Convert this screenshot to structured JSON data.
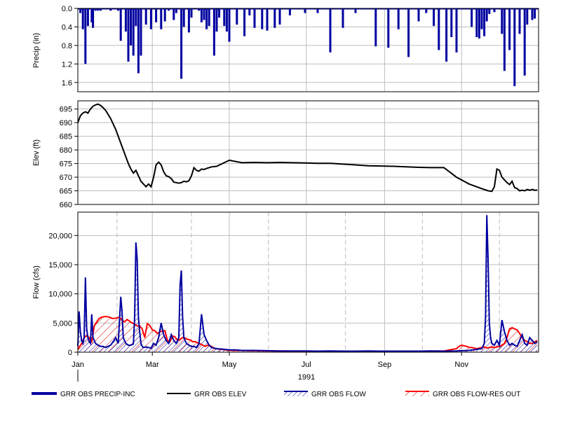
{
  "chart_data": [
    {
      "type": "bar",
      "panel": "precip",
      "ylabel": "Precip (in)",
      "ylim": [
        0,
        1.8
      ],
      "y_inverted": true,
      "yticks": [
        "0.0",
        "0.4",
        "0.8",
        "1.2",
        "1.6"
      ],
      "yticks_values": [
        0,
        0.4,
        0.8,
        1.2,
        1.6
      ],
      "grid": true,
      "color": "#0000a0",
      "x_domain": "day of year 1991",
      "series": [
        {
          "name": "GRR OBS PRECIP-INC",
          "x": [
            2,
            4,
            6,
            8,
            11,
            12,
            14,
            16,
            18,
            22,
            26,
            28,
            32,
            34,
            38,
            40,
            42,
            44,
            46,
            48,
            50,
            54,
            58,
            62,
            66,
            69,
            72,
            76,
            78,
            82,
            84,
            88,
            90,
            96,
            98,
            100,
            102,
            104,
            108,
            110,
            112,
            116,
            118,
            120,
            126,
            132,
            136,
            140,
            146,
            150,
            156,
            160,
            168,
            180,
            190,
            200,
            210,
            220,
            236,
            246,
            254,
            262,
            270,
            276,
            282,
            286,
            292,
            296,
            300,
            312,
            316,
            318,
            320,
            322,
            324,
            326,
            330,
            336,
            338,
            342,
            346,
            350,
            354,
            356,
            360,
            362
          ],
          "y": [
            0.1,
            0.45,
            1.2,
            0.38,
            0.3,
            0.42,
            0.05,
            0.05,
            0.05,
            0.02,
            0.05,
            0.02,
            0.05,
            0.7,
            0.5,
            1.15,
            0.8,
            1.02,
            0.38,
            1.4,
            1.02,
            0.35,
            0.45,
            0.3,
            0.45,
            0.28,
            0.05,
            0.25,
            0.1,
            1.52,
            0.4,
            0.52,
            0.2,
            0.05,
            0.3,
            0.25,
            0.45,
            0.38,
            1.02,
            0.5,
            0.2,
            0.38,
            0.5,
            0.72,
            0.35,
            0.6,
            0.15,
            0.42,
            0.45,
            0.48,
            0.42,
            0.35,
            0.15,
            0.1,
            0.1,
            0.95,
            0.42,
            0.1,
            0.82,
            0.85,
            0.45,
            1.05,
            0.28,
            0.1,
            0.38,
            0.9,
            1.15,
            0.62,
            0.95,
            0.4,
            0.62,
            0.65,
            0.45,
            0.6,
            0.28,
            0.12,
            0.08,
            0.55,
            1.35,
            0.9,
            1.68,
            0.55,
            1.45,
            0.35,
            0.25,
            0.22
          ]
        }
      ]
    },
    {
      "type": "line",
      "panel": "elev",
      "ylabel": "Elev (ft)",
      "ylim": [
        660,
        698
      ],
      "yticks": [
        "660",
        "665",
        "670",
        "675",
        "680",
        "685",
        "690",
        "695"
      ],
      "yticks_values": [
        660,
        665,
        670,
        675,
        680,
        685,
        690,
        695
      ],
      "grid": true,
      "series": [
        {
          "name": "GRR OBS ELEV",
          "color": "#000000",
          "x": [
            0,
            2,
            4,
            6,
            8,
            10,
            12,
            14,
            16,
            18,
            20,
            22,
            24,
            26,
            28,
            30,
            32,
            34,
            36,
            38,
            40,
            42,
            44,
            46,
            48,
            50,
            52,
            54,
            56,
            58,
            60,
            62,
            64,
            66,
            68,
            70,
            72,
            74,
            76,
            78,
            80,
            82,
            84,
            86,
            88,
            90,
            92,
            94,
            96,
            98,
            100,
            102,
            104,
            106,
            110,
            120,
            130,
            140,
            150,
            160,
            170,
            180,
            190,
            200,
            210,
            220,
            230,
            240,
            250,
            260,
            270,
            280,
            290,
            300,
            310,
            320,
            325,
            328,
            330,
            332,
            334,
            336,
            338,
            340,
            342,
            344,
            346,
            348,
            350,
            352,
            354,
            356,
            358,
            360,
            362,
            364
          ],
          "y": [
            690,
            692.5,
            693.5,
            694,
            693.5,
            695,
            696,
            696.5,
            696.8,
            696.3,
            695.5,
            694.5,
            693,
            691.5,
            689.5,
            687.5,
            685,
            682.5,
            680,
            677.5,
            675,
            673,
            671.5,
            672.5,
            670.5,
            668.5,
            667.5,
            666.5,
            667.5,
            666.5,
            670,
            674.5,
            675.5,
            674.5,
            672,
            670.5,
            670.2,
            669.5,
            668.2,
            668,
            667.8,
            668,
            668.5,
            668.3,
            668.7,
            670.5,
            673.5,
            672.5,
            672.2,
            673,
            672.8,
            673.2,
            673.5,
            673.8,
            674,
            676.2,
            675.3,
            675.4,
            675.3,
            675.4,
            675.3,
            675.2,
            675.1,
            675.1,
            674.8,
            674.5,
            674.2,
            674.1,
            674,
            673.8,
            673.6,
            673.5,
            673.5,
            670,
            667.5,
            665.8,
            665,
            664.8,
            666.5,
            673,
            672.5,
            670,
            669,
            668,
            667.3,
            668.5,
            666.2,
            665.8,
            665,
            665.2,
            665,
            665.5,
            665.2,
            665.5,
            665.2,
            665.3
          ]
        }
      ]
    },
    {
      "type": "area",
      "panel": "flow",
      "ylabel": "Flow (cfs)",
      "ylim": [
        0,
        24000
      ],
      "yticks": [
        "0",
        "5,000",
        "10,000",
        "15,000",
        "20,000"
      ],
      "yticks_values": [
        0,
        5000,
        10000,
        15000,
        20000
      ],
      "xtick_labels": [
        "Jan",
        "Mar",
        "May",
        "Jul",
        "Sep",
        "Nov"
      ],
      "xtick_days": [
        0,
        59,
        120,
        181,
        243,
        304
      ],
      "year_label": "1991",
      "grid": true,
      "series": [
        {
          "name": "GRR OBS FLOW",
          "color": "#0000a0",
          "x": [
            0,
            1,
            2,
            3,
            4,
            5,
            6,
            7,
            8,
            9,
            10,
            11,
            12,
            14,
            16,
            18,
            20,
            22,
            24,
            26,
            28,
            30,
            32,
            34,
            35,
            36,
            37,
            38,
            40,
            42,
            44,
            45,
            46,
            47,
            48,
            49,
            50,
            51,
            52,
            54,
            56,
            58,
            60,
            62,
            64,
            66,
            68,
            70,
            72,
            74,
            76,
            78,
            80,
            81,
            82,
            83,
            84,
            86,
            88,
            90,
            92,
            94,
            96,
            98,
            100,
            102,
            104,
            106,
            108,
            110,
            115,
            120,
            125,
            130,
            140,
            150,
            160,
            170,
            180,
            190,
            200,
            210,
            220,
            230,
            240,
            250,
            260,
            270,
            280,
            290,
            300,
            310,
            320,
            322,
            323,
            324,
            325,
            326,
            327,
            328,
            330,
            332,
            334,
            336,
            338,
            340,
            342,
            344,
            346,
            348,
            350,
            352,
            354,
            356,
            358,
            360,
            362,
            364
          ],
          "y": [
            1000,
            7000,
            3500,
            2000,
            1500,
            2500,
            12800,
            4000,
            2500,
            1800,
            1500,
            6500,
            2500,
            1500,
            1200,
            1000,
            1000,
            800,
            1000,
            1200,
            1800,
            2500,
            1500,
            9500,
            7000,
            2500,
            2000,
            1500,
            1200,
            1200,
            1400,
            6000,
            18800,
            16000,
            6000,
            3500,
            1500,
            1000,
            800,
            900,
            800,
            700,
            1500,
            1200,
            2500,
            5000,
            3000,
            2000,
            1500,
            3000,
            2000,
            1500,
            2500,
            11500,
            14000,
            6000,
            2500,
            1500,
            1200,
            1000,
            1000,
            800,
            1500,
            6500,
            3000,
            2000,
            1200,
            800,
            700,
            600,
            500,
            400,
            400,
            300,
            300,
            250,
            200,
            200,
            200,
            180,
            200,
            180,
            180,
            200,
            180,
            180,
            180,
            180,
            200,
            180,
            200,
            300,
            600,
            1500,
            6000,
            23500,
            16000,
            5000,
            2500,
            1500,
            1200,
            2000,
            1200,
            5500,
            3500,
            2000,
            1200,
            1500,
            1200,
            1000,
            2000,
            3000,
            1500,
            1200,
            2500,
            2000,
            1500,
            1800
          ]
        },
        {
          "name": "GRR OBS FLOW-RES OUT",
          "color": "#ff0000",
          "x": [
            0,
            3,
            5,
            7,
            9,
            11,
            13,
            15,
            17,
            19,
            21,
            23,
            25,
            27,
            29,
            31,
            33,
            35,
            37,
            39,
            41,
            43,
            45,
            47,
            49,
            51,
            53,
            55,
            57,
            59,
            61,
            63,
            65,
            67,
            69,
            71,
            73,
            75,
            77,
            79,
            81,
            83,
            85,
            87,
            89,
            91,
            93,
            95,
            97,
            99,
            101,
            103,
            105,
            107,
            109,
            113,
            117,
            121,
            125,
            135,
            150,
            170,
            200,
            230,
            260,
            290,
            300,
            302,
            304,
            306,
            308,
            310,
            312,
            314,
            316,
            318,
            320,
            322,
            324,
            326,
            328,
            330,
            332,
            334,
            336,
            338,
            340,
            342,
            344,
            346,
            348,
            350,
            352,
            354,
            356,
            358,
            360,
            362,
            364
          ],
          "y": [
            500,
            1500,
            2500,
            2800,
            2500,
            1800,
            4500,
            5200,
            5800,
            6000,
            6100,
            6100,
            6000,
            5800,
            5800,
            5900,
            6000,
            5500,
            5200,
            5600,
            5300,
            5000,
            4800,
            4500,
            4500,
            4000,
            2500,
            4900,
            4600,
            3800,
            3700,
            3200,
            3500,
            3600,
            3700,
            2000,
            1800,
            2800,
            2600,
            2000,
            2200,
            2500,
            2400,
            2200,
            2100,
            1800,
            1800,
            1600,
            1400,
            1200,
            1000,
            1200,
            1100,
            800,
            600,
            500,
            400,
            300,
            300,
            250,
            200,
            180,
            150,
            150,
            150,
            200,
            600,
            1000,
            1200,
            1100,
            1000,
            800,
            800,
            700,
            600,
            700,
            800,
            900,
            700,
            800,
            900,
            800,
            900,
            1000,
            1200,
            1500,
            2500,
            4000,
            4200,
            4000,
            3800,
            3200,
            2500,
            2000,
            1800,
            1500,
            1500,
            1800,
            2000
          ]
        }
      ]
    }
  ],
  "legend": [
    {
      "label": "GRR OBS PRECIP-INC",
      "style": "thick-line",
      "color": "#0000a0"
    },
    {
      "label": "GRR OBS ELEV",
      "style": "line",
      "color": "#000000"
    },
    {
      "label": "GRR OBS FLOW",
      "style": "hatched",
      "color": "#0000a0"
    },
    {
      "label": "GRR OBS FLOW-RES OUT",
      "style": "hatched",
      "color": "#ff0000"
    }
  ]
}
